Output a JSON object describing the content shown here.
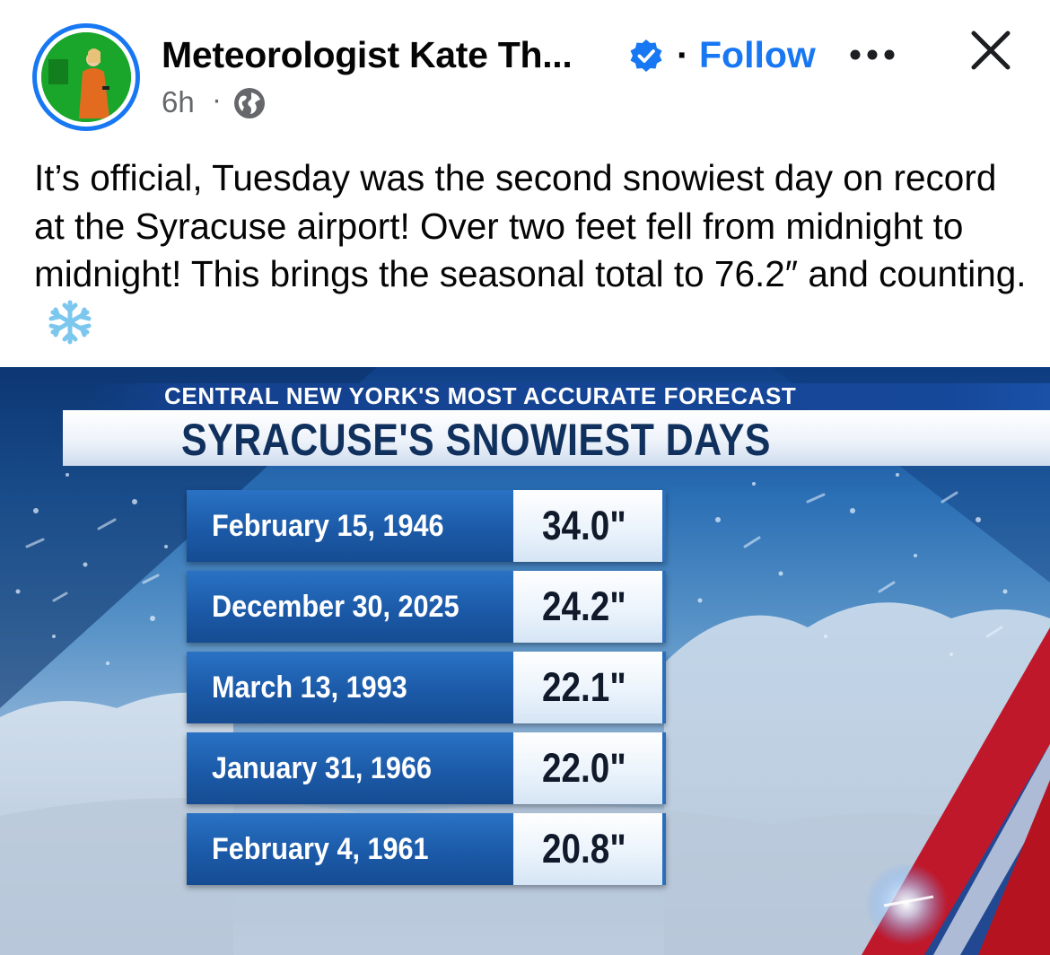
{
  "post": {
    "author": "Meteorologist Kate Th...",
    "separator": "·",
    "follow_label": "Follow",
    "timestamp": "6h",
    "meta_separator": "·",
    "text": "It’s official, Tuesday was the second snowiest day on record at the Syracuse airport! Over two feet fell from midnight to midnight! This brings the seasonal total to 76.2″ and counting."
  },
  "icons": {
    "verified": "verified-badge-icon",
    "more": "more-options-icon",
    "close": "close-icon",
    "audience": "globe-icon",
    "emoji": "snowflake-icon"
  },
  "colors": {
    "accent": "#1877f2",
    "secondary_text": "#65676b"
  },
  "graphic": {
    "subtitle": "CENTRAL NEW YORK'S MOST ACCURATE FORECAST",
    "title": "SYRACUSE'S SNOWIEST DAYS",
    "rows": [
      {
        "date": "February 15, 1946",
        "amount": "34.0\""
      },
      {
        "date": "December 30, 2025",
        "amount": "24.2\""
      },
      {
        "date": "March 13, 1993",
        "amount": "22.1\""
      },
      {
        "date": "January 31, 1966",
        "amount": "22.0\""
      },
      {
        "date": "February 4, 1961",
        "amount": "20.8\""
      }
    ]
  }
}
